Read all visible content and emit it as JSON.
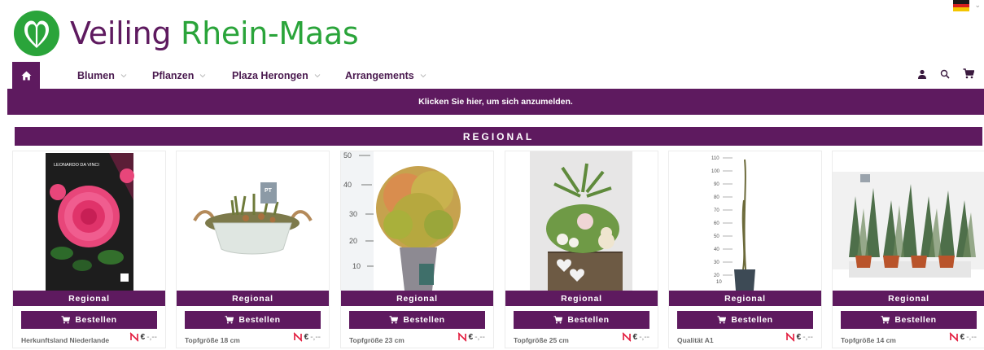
{
  "brand": {
    "word1": "Veiling",
    "word2": "Rhein-Maas",
    "colors": {
      "purple": "#5e1a5f",
      "green": "#2aa43a"
    }
  },
  "language": {
    "flag": "de-flag-icon"
  },
  "nav": {
    "home_icon": "home-icon",
    "items": [
      {
        "label": "Blumen"
      },
      {
        "label": "Pflanzen"
      },
      {
        "label": "Plaza Herongen"
      },
      {
        "label": "Arrangements"
      }
    ],
    "icons": [
      "user-icon",
      "search-icon",
      "cart-icon"
    ]
  },
  "login_banner": "Klicken Sie hier, um sich anzumelden.",
  "section_title": "REGIONAL",
  "products": [
    {
      "tag": "Regional",
      "button": "Bestellen",
      "info": "Herkunftsland Niederlande",
      "price_symbol": "€",
      "price": "-,--",
      "image_text": "LEONARDO DA VINCI"
    },
    {
      "tag": "Regional",
      "button": "Bestellen",
      "info": "Topfgröße 18 cm",
      "price_symbol": "€",
      "price": "-,--",
      "image_text": "PT"
    },
    {
      "tag": "Regional",
      "button": "Bestellen",
      "info": "Topfgröße 23 cm",
      "price_symbol": "€",
      "price": "-,--",
      "ruler": [
        "50",
        "40",
        "30",
        "20",
        "10"
      ]
    },
    {
      "tag": "Regional",
      "button": "Bestellen",
      "info": "Topfgröße 25 cm",
      "price_symbol": "€",
      "price": "-,--"
    },
    {
      "tag": "Regional",
      "button": "Bestellen",
      "info": "Qualität A1",
      "price_symbol": "€",
      "price": "-,--",
      "ruler": [
        "110",
        "100",
        "90",
        "80",
        "70",
        "60",
        "50",
        "40",
        "30",
        "20",
        "10"
      ]
    },
    {
      "tag": "Regional",
      "button": "Bestellen",
      "info": "Topfgröße 14 cm",
      "price_symbol": "€",
      "price": "-,--"
    }
  ]
}
